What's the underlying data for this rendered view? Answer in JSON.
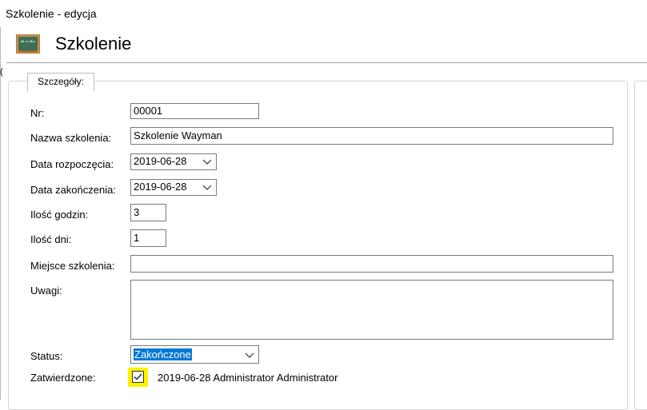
{
  "window": {
    "title": "Szkolenie - edycja"
  },
  "header": {
    "title": "Szkolenie",
    "icon": "chalkboard-icon"
  },
  "group": {
    "title": "Szczegóły:"
  },
  "form": {
    "nr": {
      "label": "Nr:",
      "value": "00001"
    },
    "nazwa": {
      "label": "Nazwa szkolenia:",
      "value": "Szkolenie Wayman"
    },
    "data_rozp": {
      "label": "Data rozpoczęcia:",
      "value": "2019-06-28"
    },
    "data_zak": {
      "label": "Data zakończenia:",
      "value": "2019-06-28"
    },
    "godziny": {
      "label": "Ilość godzin:",
      "value": "3"
    },
    "dni": {
      "label": "Ilość dni:",
      "value": "1"
    },
    "miejsce": {
      "label": "Miejsce szkolenia:",
      "value": ""
    },
    "uwagi": {
      "label": "Uwagi:",
      "value": ""
    },
    "status": {
      "label": "Status:",
      "value": "Zakończone"
    },
    "zatwierdzone": {
      "label": "Zatwierdzone:",
      "checked": true,
      "info": "2019-06-28 Administrator Administrator"
    }
  },
  "colors": {
    "selection": "#0078d7",
    "highlight": "#fff200",
    "border": "#7a7a7a"
  }
}
